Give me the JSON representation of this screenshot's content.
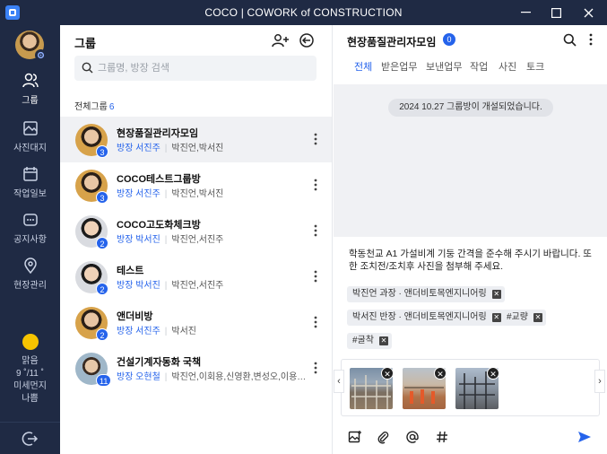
{
  "window": {
    "title": "COCO | COWORK of CONSTRUCTION"
  },
  "rail": {
    "items": [
      {
        "label": "그룹",
        "icon": "group-icon",
        "active": true
      },
      {
        "label": "사진대지",
        "icon": "photo-board-icon",
        "active": false
      },
      {
        "label": "작업일보",
        "icon": "work-log-icon",
        "active": false
      },
      {
        "label": "공지사항",
        "icon": "notice-icon",
        "active": false
      },
      {
        "label": "현장관리",
        "icon": "site-location-icon",
        "active": false
      }
    ],
    "weather": {
      "condition": "맑음",
      "temp": "9 ˚/11 ˚",
      "dust_label": "미세먼지",
      "dust_value": "나쁨",
      "color": "#f6c400"
    }
  },
  "group_list": {
    "title": "그룹",
    "search_placeholder": "그룹명, 방장 검색",
    "count_label": "전체그룹",
    "count": "6",
    "groups": [
      {
        "name": "현장품질관리자모임",
        "leader": "방장 서진주",
        "members": "박진언,박서진",
        "badge": "3",
        "selected": true
      },
      {
        "name": "COCO테스트그룹방",
        "leader": "방장 서진주",
        "members": "박진언,박서진",
        "badge": "3",
        "selected": false
      },
      {
        "name": "COCO고도화체크방",
        "leader": "방장 박서진",
        "members": "박진언,서진주",
        "badge": "2",
        "selected": false
      },
      {
        "name": "테스트",
        "leader": "방장 박서진",
        "members": "박진언,서진주",
        "badge": "2",
        "selected": false
      },
      {
        "name": "앤더비방",
        "leader": "방장 서진주",
        "members": "박서진",
        "badge": "2",
        "selected": false
      },
      {
        "name": "건설기계자동화 국책",
        "leader": "방장 오현철",
        "members": "박진언,이회용,신영환,변성오,이용…",
        "badge": "11",
        "selected": false
      }
    ]
  },
  "chat": {
    "title": "현장품질관리자모임",
    "badge": "0",
    "tabs": [
      "전체",
      "받은업무",
      "보낸업무",
      "작업",
      "사진",
      "토크"
    ],
    "active_tab": "전체",
    "system_message": "2024 10.27 그룹방이 개설되었습니다.",
    "compose_text": "학동천교 A1 가설비계 기둥 간격을 준수해 주시기 바랍니다. 또한 조치전/조치후 사진을 첨부해 주세요.",
    "chips": [
      "박진언 과장 · 앤더비토목엔지니어링",
      "박서진 반장 · 앤더비토목엔지니어링",
      "#교량",
      "#굴착"
    ],
    "attachments": 3,
    "accent": "#2563eb"
  }
}
